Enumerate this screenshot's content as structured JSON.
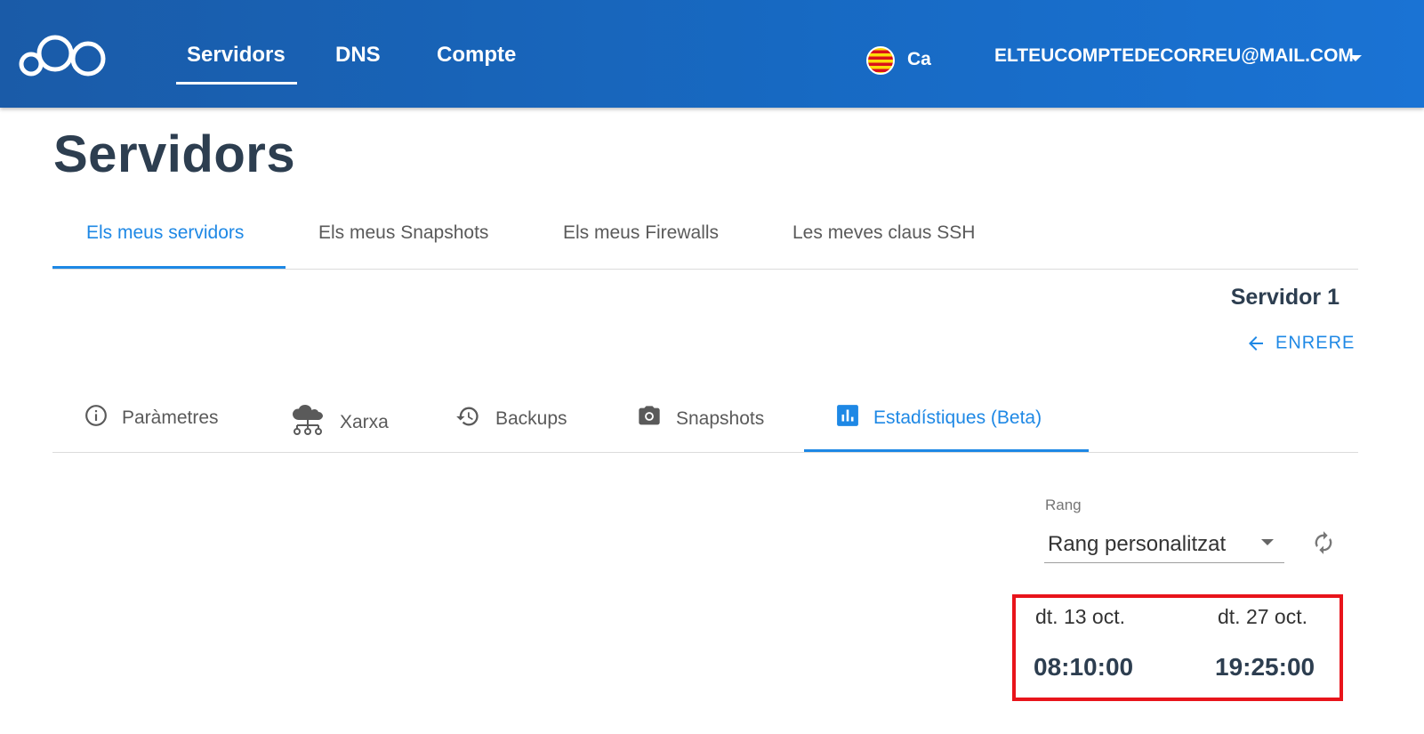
{
  "header": {
    "logo_icon": "cloud-circles-logo-icon",
    "nav": [
      "Servidors",
      "DNS",
      "Compte"
    ],
    "language": {
      "flag_icon": "catalan-flag-icon",
      "code": "Ca"
    },
    "account": "ELTEUCOMPTEDECORREU@MAIL.COM",
    "colors": {
      "bar": "#1769c2",
      "text": "#ffffff"
    }
  },
  "page": {
    "title": "Servidors"
  },
  "top_tabs": [
    "Els meus servidors",
    "Els meus Snapshots",
    "Els meus Firewalls",
    "Les meves claus SSH"
  ],
  "server": {
    "name": "Servidor 1",
    "back_label": "ENRERE"
  },
  "sub_tabs": [
    {
      "label": "Paràmetres",
      "icon": "info-icon"
    },
    {
      "label": "Xarxa",
      "icon": "cloud-network-icon"
    },
    {
      "label": "Backups",
      "icon": "history-icon"
    },
    {
      "label": "Snapshots",
      "icon": "camera-icon"
    },
    {
      "label": "Estadístiques (Beta)",
      "icon": "bar-chart-icon",
      "active": true
    }
  ],
  "range": {
    "label": "Rang",
    "value": "Rang personalitzat",
    "refresh_icon": "refresh-icon",
    "start": {
      "date": "dt. 13 oct.",
      "time": "08:10:00"
    },
    "end": {
      "date": "dt. 27 oct.",
      "time": "19:25:00"
    }
  },
  "colors": {
    "accent": "#1e88e5",
    "highlight": "#e8141b",
    "title": "#2d3e50"
  }
}
